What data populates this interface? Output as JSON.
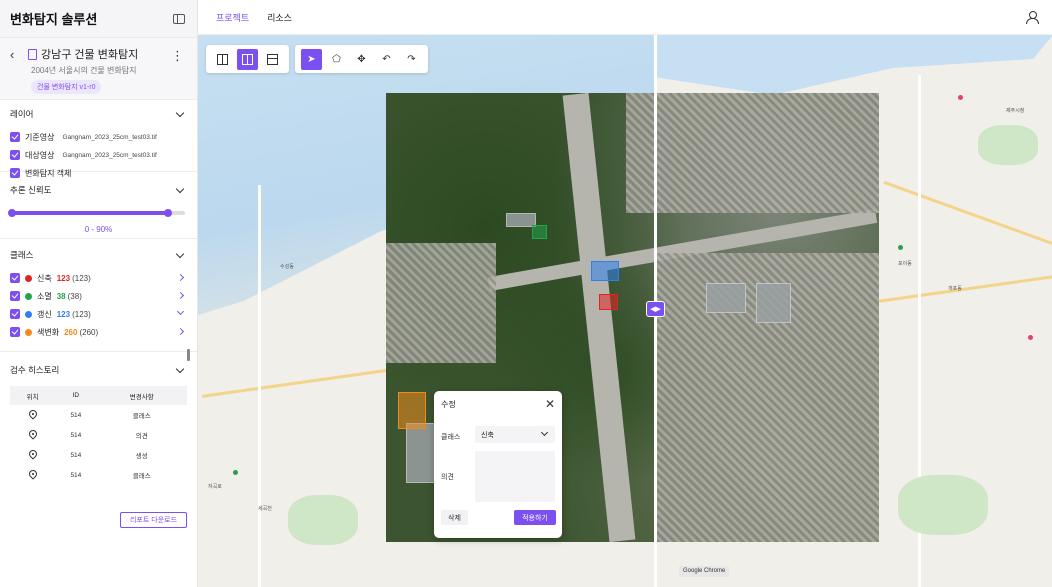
{
  "app": {
    "title": "변화탐지 솔루션"
  },
  "project": {
    "name": "강남구 건물 변화탐지",
    "subtitle": "2004년 서울시의 건물 변화탐지",
    "version": "건물 변화탐지 v1-r0"
  },
  "topnav": {
    "tabs": [
      {
        "label": "프로젝트",
        "active": true
      },
      {
        "label": "리소스",
        "active": false
      }
    ]
  },
  "layers": {
    "title": "레이어",
    "items": [
      {
        "label": "기준영상",
        "file": "Gangnam_2023_25cm_test03.tif",
        "checked": true
      },
      {
        "label": "대상영상",
        "file": "Gangnam_2023_25cm_test03.tif",
        "checked": true
      },
      {
        "label": "변화탐지 객체",
        "file": "",
        "checked": true
      }
    ]
  },
  "confidence": {
    "title": "추론 신뢰도",
    "range": [
      0,
      0.9
    ],
    "value_text": "0 - 90%"
  },
  "classes": {
    "title": "클래스",
    "items": [
      {
        "name": "신축",
        "count": "123",
        "total": "(123)",
        "color": "#e02424"
      },
      {
        "name": "소멸",
        "count": "38",
        "total": "(38)",
        "color": "#22a44a"
      },
      {
        "name": "갱신",
        "count": "123",
        "total": "(123)",
        "color": "#2f7ff0"
      },
      {
        "name": "색변화",
        "count": "260",
        "total": "(260)",
        "color": "#f08a1c"
      }
    ]
  },
  "history": {
    "title": "검수 히스토리",
    "columns": [
      "위치",
      "ID",
      "변경사항"
    ],
    "rows": [
      {
        "id": "514",
        "change": "클래스"
      },
      {
        "id": "514",
        "change": "의견"
      },
      {
        "id": "514",
        "change": "생성"
      },
      {
        "id": "514",
        "change": "클래스"
      }
    ]
  },
  "report_button": "리포트 다운로드",
  "edit_popup": {
    "title": "수정",
    "class_label": "클래스",
    "class_value": "신축",
    "comment_label": "의견",
    "delete_label": "삭제",
    "apply_label": "적용하기"
  },
  "map": {
    "chrome_label": "Google Chrome",
    "pois": [
      "수성동",
      "자곡로",
      "개포동",
      "세곡천",
      "포이동",
      "제주시청"
    ]
  },
  "colors": {
    "accent": "#7b4ff0",
    "new": "#e02424",
    "removed": "#22a44a",
    "updated": "#2f7ff0",
    "color_change": "#f08a1c"
  }
}
